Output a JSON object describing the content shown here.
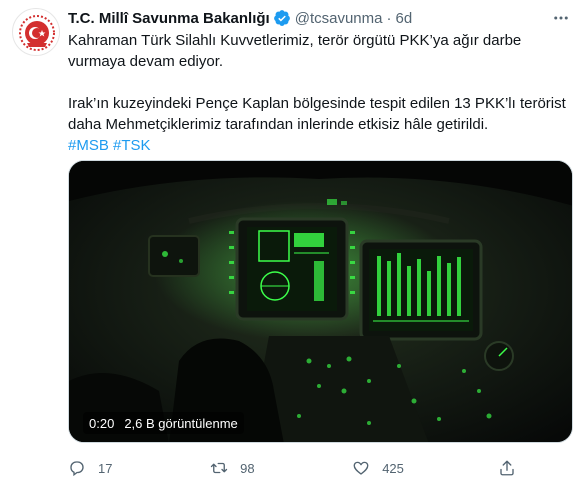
{
  "tweet": {
    "display_name": "T.C. Millî Savunma Bakanlığı",
    "handle": "@tcsavunma",
    "separator": "·",
    "time": "6d",
    "text_line1": "Kahraman Türk Silahlı Kuvvetlerimiz, terör örgütü PKK’ya ağır darbe vurmaya devam ediyor.",
    "text_line2": "Irak’ın kuzeyindeki Pençe Kaplan bölgesinde tespit edilen 13 PKK’lı terörist daha Mehmetçiklerimiz tarafından inlerinde etkisiz hâle getirildi.",
    "hashtags": [
      "#MSB",
      "#TSK"
    ]
  },
  "media": {
    "duration": "0:20",
    "views": "2,6 B görüntülenme"
  },
  "actions": {
    "reply_count": "17",
    "retweet_count": "98",
    "like_count": "425"
  },
  "colors": {
    "accent": "#1d9bf0",
    "secondary_text": "#536471",
    "avatar_red": "#d32f2f",
    "cockpit_green": "#3cff4a"
  },
  "icons": {
    "avatar": "msb-emblem-icon",
    "verified": "verified-badge-icon",
    "more": "more-dots-icon",
    "reply": "reply-icon",
    "retweet": "retweet-icon",
    "like": "heart-icon",
    "share": "share-icon"
  }
}
